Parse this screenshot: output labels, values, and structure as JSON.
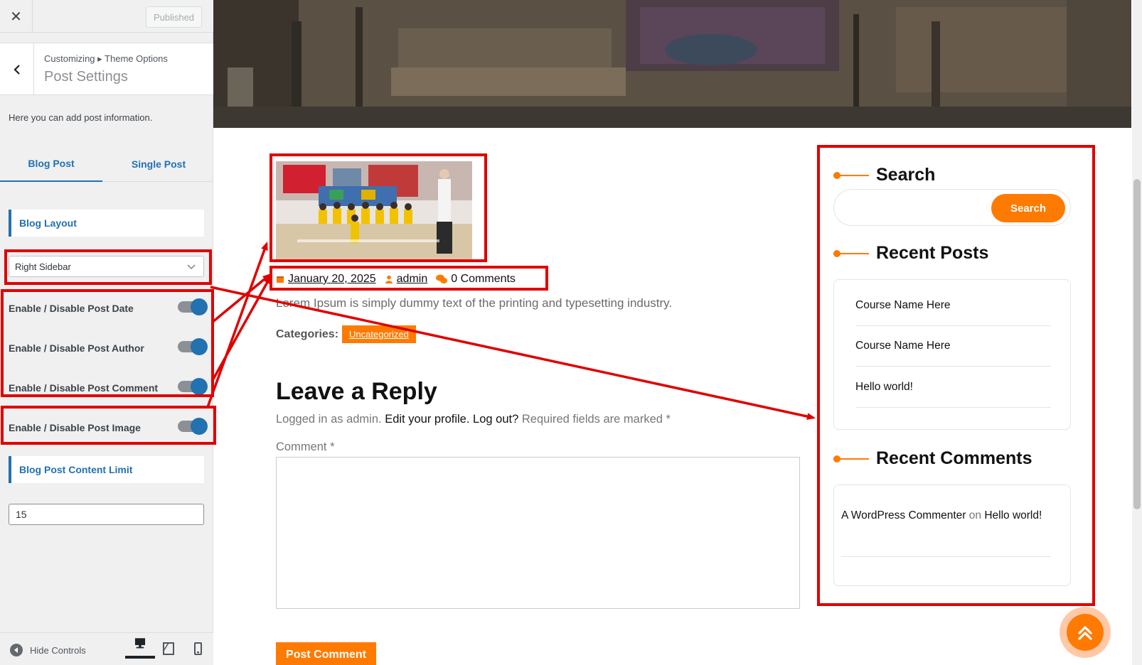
{
  "customizer": {
    "close_glyph": "✕",
    "published_label": "Published",
    "breadcrumb": "Customizing ▸ Theme Options",
    "title": "Post Settings",
    "description": "Here you can add post information.",
    "tabs": [
      {
        "label": "Blog Post",
        "active": true
      },
      {
        "label": "Single Post",
        "active": false
      }
    ],
    "blog_layout_heading": "Blog Layout",
    "layout_select_value": "Right Sidebar",
    "toggles": [
      {
        "label": "Enable / Disable Post Date",
        "on": true
      },
      {
        "label": "Enable / Disable Post Author",
        "on": true
      },
      {
        "label": "Enable / Disable Post Comment",
        "on": true
      },
      {
        "label": "Enable / Disable Post Image",
        "on": true
      }
    ],
    "content_limit_heading": "Blog Post Content Limit",
    "content_limit_value": "15",
    "hide_controls_label": "Hide Controls",
    "accent_color": "#2271b1"
  },
  "preview": {
    "post": {
      "date": "January 20, 2025",
      "author": "admin",
      "comments": "0 Comments",
      "excerpt": "Lorem Ipsum is simply dummy text of the printing and typesetting industry.",
      "categories_label": "Categories:",
      "category": "Uncategorized"
    },
    "reply": {
      "title": "Leave a Reply",
      "logged_in_prefix": "Logged in as admin.",
      "edit_profile": "Edit your profile.",
      "log_out": "Log out?",
      "required_note": "Required fields are marked *",
      "comment_label": "Comment *",
      "submit_label": "Post Comment"
    },
    "sidebar": {
      "search_title": "Search",
      "search_button": "Search",
      "recent_posts_title": "Recent Posts",
      "recent_posts": [
        "Course Name Here",
        "Course Name Here",
        "Hello world!"
      ],
      "recent_comments_title": "Recent Comments",
      "recent_comment": {
        "author": "A WordPress Commenter",
        "on": "on",
        "post": "Hello world!"
      }
    },
    "accent_color": "#ff7a00",
    "annotation_color": "#e00000"
  }
}
